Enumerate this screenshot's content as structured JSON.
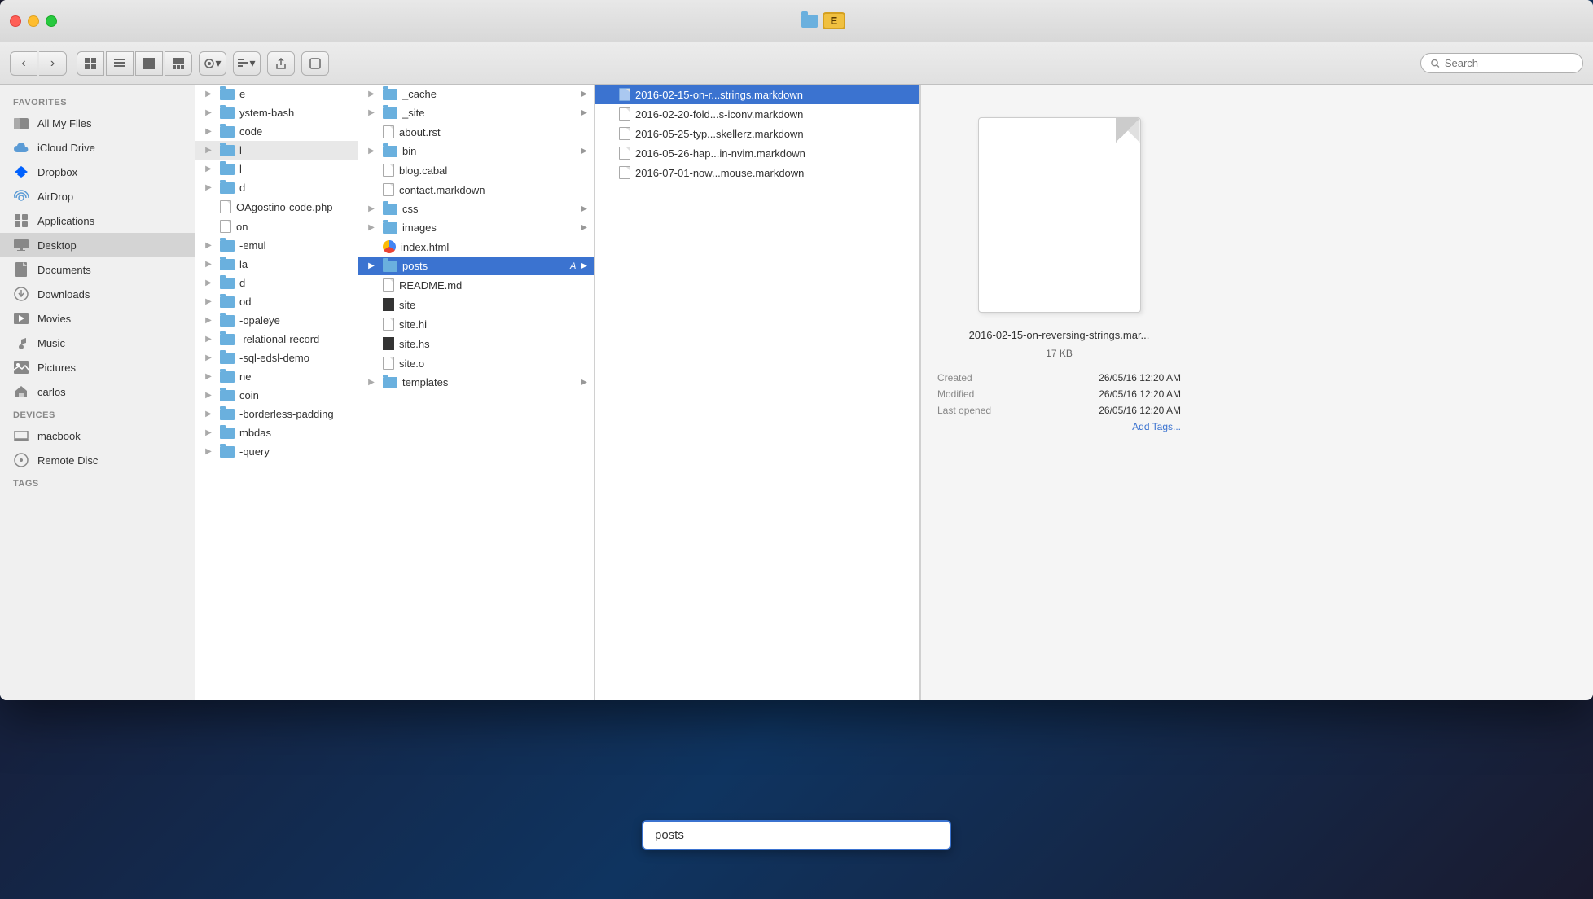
{
  "window": {
    "title": "E",
    "traffic_lights": [
      "close",
      "minimize",
      "maximize"
    ]
  },
  "toolbar": {
    "back_label": "‹",
    "forward_label": "›",
    "view_icon": "⊞",
    "list_icon": "☰",
    "column_icon": "⊟",
    "cover_icon": "⊠",
    "action_label": "⚙",
    "arrange_label": "⊞",
    "share_label": "↑",
    "tag_label": "⬜",
    "search_placeholder": "Search"
  },
  "sidebar": {
    "favorites_header": "Favorites",
    "items": [
      {
        "id": "all-my-files",
        "label": "All My Files",
        "icon": "🗂"
      },
      {
        "id": "icloud-drive",
        "label": "iCloud Drive",
        "icon": "☁"
      },
      {
        "id": "dropbox",
        "label": "Dropbox",
        "icon": "📦"
      },
      {
        "id": "airdrop",
        "label": "AirDrop",
        "icon": "📡"
      },
      {
        "id": "applications",
        "label": "Applications",
        "icon": "🧩"
      },
      {
        "id": "desktop",
        "label": "Desktop",
        "icon": "🖥",
        "active": true
      },
      {
        "id": "documents",
        "label": "Documents",
        "icon": "📄"
      },
      {
        "id": "downloads",
        "label": "Downloads",
        "icon": "⬇"
      },
      {
        "id": "movies",
        "label": "Movies",
        "icon": "🎬"
      },
      {
        "id": "music",
        "label": "Music",
        "icon": "🎵"
      },
      {
        "id": "pictures",
        "label": "Pictures",
        "icon": "📷"
      },
      {
        "id": "carlos",
        "label": "carlos",
        "icon": "🏠"
      }
    ],
    "devices_header": "Devices",
    "devices": [
      {
        "id": "macbook",
        "label": "macbook",
        "icon": "💻"
      },
      {
        "id": "remote-disc",
        "label": "Remote Disc",
        "icon": "💿"
      }
    ],
    "tags_header": "Tags"
  },
  "col1": {
    "items": [
      {
        "id": "item1",
        "label": "e",
        "type": "text",
        "has_arrow": false
      },
      {
        "id": "item2",
        "label": "ystem-bash",
        "type": "text",
        "has_arrow": false
      },
      {
        "id": "item3",
        "label": "code",
        "type": "text",
        "has_arrow": false
      },
      {
        "id": "item4",
        "label": "l",
        "type": "text",
        "has_arrow": true
      },
      {
        "id": "item5",
        "label": "l",
        "type": "text",
        "has_arrow": true
      },
      {
        "id": "item6",
        "label": "d",
        "type": "text",
        "has_arrow": true
      },
      {
        "id": "item7",
        "label": "OAgostino-code.php",
        "type": "file",
        "has_arrow": false
      },
      {
        "id": "item8",
        "label": "on",
        "type": "text",
        "has_arrow": false
      },
      {
        "id": "item9",
        "label": "-emul",
        "type": "text",
        "has_arrow": false
      },
      {
        "id": "item10",
        "label": "la",
        "type": "text",
        "has_arrow": false
      },
      {
        "id": "item11",
        "label": "d",
        "type": "text",
        "has_arrow": false
      },
      {
        "id": "item12",
        "label": "od",
        "type": "text",
        "has_arrow": false
      },
      {
        "id": "item13",
        "label": "-opaleye",
        "type": "text",
        "has_arrow": false
      },
      {
        "id": "item14",
        "label": "-relational-record",
        "type": "text",
        "has_arrow": false
      },
      {
        "id": "item15",
        "label": "-sql-edsl-demo",
        "type": "text",
        "has_arrow": false
      },
      {
        "id": "item16",
        "label": "ne",
        "type": "text",
        "has_arrow": false
      },
      {
        "id": "item17",
        "label": "coin",
        "type": "text",
        "has_arrow": false
      },
      {
        "id": "item18",
        "label": "-borderless-padding",
        "type": "text",
        "has_arrow": false
      },
      {
        "id": "item19",
        "label": "mbdas",
        "type": "text",
        "has_arrow": false
      },
      {
        "id": "item20",
        "label": "-query",
        "type": "text",
        "has_arrow": false
      }
    ]
  },
  "col2": {
    "items": [
      {
        "id": "cache",
        "label": "_cache",
        "type": "folder",
        "has_arrow": true
      },
      {
        "id": "site",
        "label": "_site",
        "type": "folder",
        "has_arrow": true
      },
      {
        "id": "about",
        "label": "about.rst",
        "type": "file",
        "has_arrow": false
      },
      {
        "id": "bin",
        "label": "bin",
        "type": "folder",
        "has_arrow": true
      },
      {
        "id": "blog",
        "label": "blog.cabal",
        "type": "file",
        "has_arrow": false
      },
      {
        "id": "contact",
        "label": "contact.markdown",
        "type": "file",
        "has_arrow": false
      },
      {
        "id": "css",
        "label": "css",
        "type": "folder",
        "has_arrow": true
      },
      {
        "id": "images",
        "label": "images",
        "type": "folder",
        "has_arrow": true
      },
      {
        "id": "index",
        "label": "index.html",
        "type": "chrome",
        "has_arrow": false
      },
      {
        "id": "posts",
        "label": "posts",
        "type": "folder",
        "has_arrow": true,
        "selected": true,
        "badge": "A"
      },
      {
        "id": "readme",
        "label": "README.md",
        "type": "file",
        "has_arrow": false
      },
      {
        "id": "site2",
        "label": "site",
        "type": "black",
        "has_arrow": false
      },
      {
        "id": "site-hi",
        "label": "site.hi",
        "type": "file",
        "has_arrow": false
      },
      {
        "id": "site-hs",
        "label": "site.hs",
        "type": "black",
        "has_arrow": false
      },
      {
        "id": "site-o",
        "label": "site.o",
        "type": "file",
        "has_arrow": false
      },
      {
        "id": "templates",
        "label": "templates",
        "type": "folder",
        "has_arrow": true
      }
    ]
  },
  "col3": {
    "items": [
      {
        "id": "f1",
        "label": "2016-02-15-on-r...strings.markdown",
        "type": "file",
        "selected": true
      },
      {
        "id": "f2",
        "label": "2016-02-20-fold...s-iconv.markdown",
        "type": "file"
      },
      {
        "id": "f3",
        "label": "2016-05-25-typ...skellerz.markdown",
        "type": "file"
      },
      {
        "id": "f4",
        "label": "2016-05-26-hap...in-nvim.markdown",
        "type": "file"
      },
      {
        "id": "f5",
        "label": "2016-07-01-now...mouse.markdown",
        "type": "file"
      }
    ]
  },
  "preview": {
    "filename": "2016-02-15-on-reversing-strings.mar...",
    "filesize": "17 KB",
    "created_label": "Created",
    "created_value": "26/05/16 12:20 AM",
    "modified_label": "Modified",
    "modified_value": "26/05/16 12:20 AM",
    "last_opened_label": "Last opened",
    "last_opened_value": "26/05/16 12:20 AM",
    "add_tags": "Add Tags..."
  },
  "rename_input": {
    "value": "posts",
    "placeholder": "posts"
  }
}
